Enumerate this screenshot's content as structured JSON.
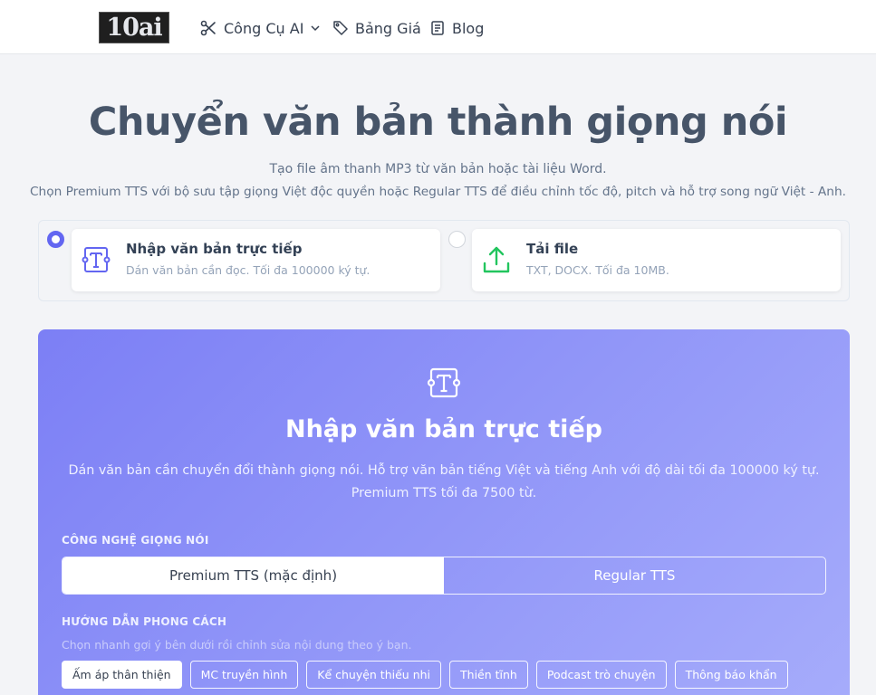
{
  "nav": {
    "logo": "10ai",
    "items": [
      {
        "label": "Công Cụ AI",
        "icon": "tools-icon"
      },
      {
        "label": "Bảng Giá",
        "icon": "tag-icon"
      },
      {
        "label": "Blog",
        "icon": "document-icon"
      }
    ]
  },
  "hero": {
    "title": "Chuyển văn bản thành giọng nói",
    "subtitle1": "Tạo file âm thanh MP3 từ văn bản hoặc tài liệu Word.",
    "subtitle2": "Chọn Premium TTS với bộ sưu tập giọng Việt độc quyền hoặc Regular TTS để điều chỉnh tốc độ, pitch và hỗ trợ song ngữ Việt - Anh."
  },
  "modes": [
    {
      "title": "Nhập văn bản trực tiếp",
      "desc": "Dán văn bản cần đọc. Tối đa 100000 ký tự.",
      "selected": true
    },
    {
      "title": "Tải file",
      "desc": "TXT, DOCX. Tối đa 10MB.",
      "selected": false
    }
  ],
  "panel": {
    "title": "Nhập văn bản trực tiếp",
    "desc1": "Dán văn bản cần chuyển đổi thành giọng nói. Hỗ trợ văn bản tiếng Việt và tiếng Anh với độ dài tối đa 100000 ký tự.",
    "desc2": "Premium TTS tối đa 7500 từ.",
    "tech_label": "CÔNG NGHỆ GIỌNG NÓI",
    "tech_options": [
      "Premium TTS (mặc định)",
      "Regular TTS"
    ],
    "tech_selected": "Premium TTS (mặc định)",
    "style_label": "HƯỚNG DẪN PHONG CÁCH",
    "style_hint": "Chọn nhanh gợi ý bên dưới rồi chỉnh sửa nội dung theo ý bạn.",
    "styles": [
      "Ấm áp thân thiện",
      "MC truyền hình",
      "Kể chuyện thiếu nhi",
      "Thiền tĩnh",
      "Podcast trò chuyện",
      "Thông báo khẩn"
    ],
    "style_selected": "Ấm áp thân thiện"
  },
  "colors": {
    "accent": "#6366f1",
    "upload_green": "#22c55e",
    "panel_gradient_start": "#7c7ff5",
    "panel_gradient_end": "#a6acfb"
  }
}
